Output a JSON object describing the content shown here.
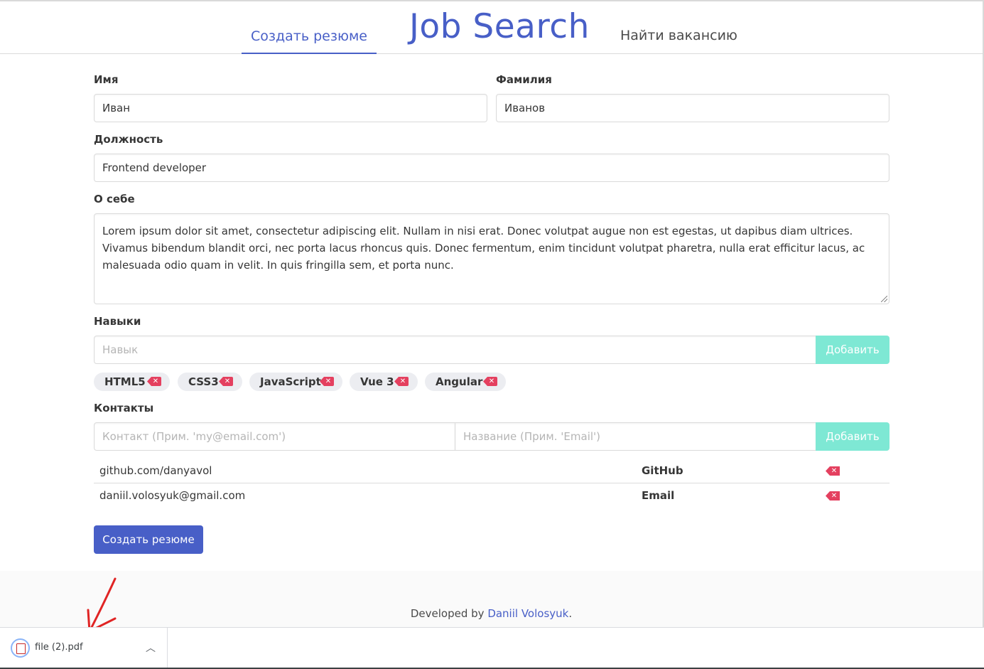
{
  "header": {
    "tab_create": "Создать резюме",
    "logo": "Job Search",
    "tab_find": "Найти вакансию"
  },
  "form": {
    "first_name_label": "Имя",
    "first_name_value": "Иван",
    "last_name_label": "Фамилия",
    "last_name_value": "Иванов",
    "position_label": "Должность",
    "position_value": "Frontend developer",
    "about_label": "О себе",
    "about_value": "Lorem ipsum dolor sit amet, consectetur adipiscing elit. Nullam in nisi erat. Donec volutpat augue non est egestas, ut dapibus diam ultrices. Vivamus bibendum blandit orci, nec porta lacus rhoncus quis. Donec fermentum, enim tincidunt volutpat pharetra, nulla erat efficitur lacus, ac malesuada odio quam in velit. In quis fringilla sem, et porta nunc.",
    "skills_label": "Навыки",
    "skill_placeholder": "Навык",
    "add_skill_button": "Добавить",
    "skills": [
      "HTML5",
      "CSS3",
      "JavaScript",
      "Vue 3",
      "Angular"
    ],
    "contacts_label": "Контакты",
    "contact_placeholder": "Контакт (Прим. 'my@email.com')",
    "contact_name_placeholder": "Название (Прим. 'Email')",
    "add_contact_button": "Добавить",
    "contacts": [
      {
        "value": "github.com/danyavol",
        "name": "GitHub"
      },
      {
        "value": "daniil.volosyuk@gmail.com",
        "name": "Email"
      }
    ],
    "submit_button": "Создать резюме"
  },
  "footer": {
    "prefix": "Developed by ",
    "author": "Daniil Volosyuk",
    "suffix": "."
  },
  "download_bar": {
    "file_name": "file (2).pdf"
  },
  "colors": {
    "accent": "#485fc7",
    "add_button": "#7ee8d4",
    "delete": "#e4405f"
  }
}
